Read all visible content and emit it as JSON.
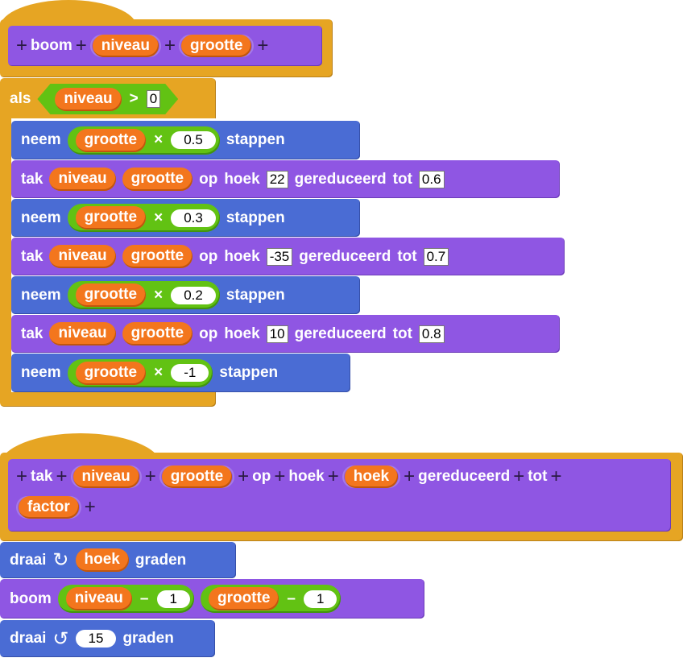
{
  "colors": {
    "control": "#E6A523",
    "custom": "#8F56E3",
    "motion": "#4A6CD4",
    "operators": "#62C213",
    "variables": "#F3761D"
  },
  "def1": {
    "plus": "+",
    "name": "boom",
    "params": [
      "niveau",
      "grootte"
    ]
  },
  "if_block": {
    "label": "als",
    "var": "niveau",
    "op": ">",
    "value": "0"
  },
  "body": [
    {
      "type": "neem",
      "label": "neem",
      "var": "grootte",
      "op": "×",
      "value": "0.5",
      "suffix": "stappen"
    },
    {
      "type": "tak",
      "label": "tak",
      "args": [
        "niveau",
        "grootte"
      ],
      "op": "op",
      "hoek": "hoek",
      "angle": "22",
      "red": "gereduceerd",
      "tot": "tot",
      "factor": "0.6"
    },
    {
      "type": "neem",
      "label": "neem",
      "var": "grootte",
      "op": "×",
      "value": "0.3",
      "suffix": "stappen"
    },
    {
      "type": "tak",
      "label": "tak",
      "args": [
        "niveau",
        "grootte"
      ],
      "op": "op",
      "hoek": "hoek",
      "angle": "-35",
      "red": "gereduceerd",
      "tot": "tot",
      "factor": "0.7"
    },
    {
      "type": "neem",
      "label": "neem",
      "var": "grootte",
      "op": "×",
      "value": "0.2",
      "suffix": "stappen"
    },
    {
      "type": "tak",
      "label": "tak",
      "args": [
        "niveau",
        "grootte"
      ],
      "op": "op",
      "hoek": "hoek",
      "angle": "10",
      "red": "gereduceerd",
      "tot": "tot",
      "factor": "0.8"
    },
    {
      "type": "neem",
      "label": "neem",
      "var": "grootte",
      "op": "×",
      "value": "-1",
      "suffix": "stappen"
    }
  ],
  "def2": {
    "name": "tak",
    "params": [
      "niveau",
      "grootte",
      "hoek",
      "factor"
    ],
    "words": [
      "op",
      "hoek",
      "gereduceerd",
      "tot"
    ]
  },
  "script2": {
    "turn_right": {
      "label": "draai",
      "icon": "rotate-clockwise-icon",
      "var": "hoek",
      "suffix": "graden"
    },
    "boom": {
      "label": "boom",
      "var1": "niveau",
      "op1": "–",
      "val1": "1",
      "var2": "grootte",
      "op2": "–",
      "val2": "1"
    },
    "turn_left": {
      "label": "draai",
      "icon": "rotate-counterclockwise-icon",
      "value": "15",
      "suffix": "graden"
    }
  }
}
